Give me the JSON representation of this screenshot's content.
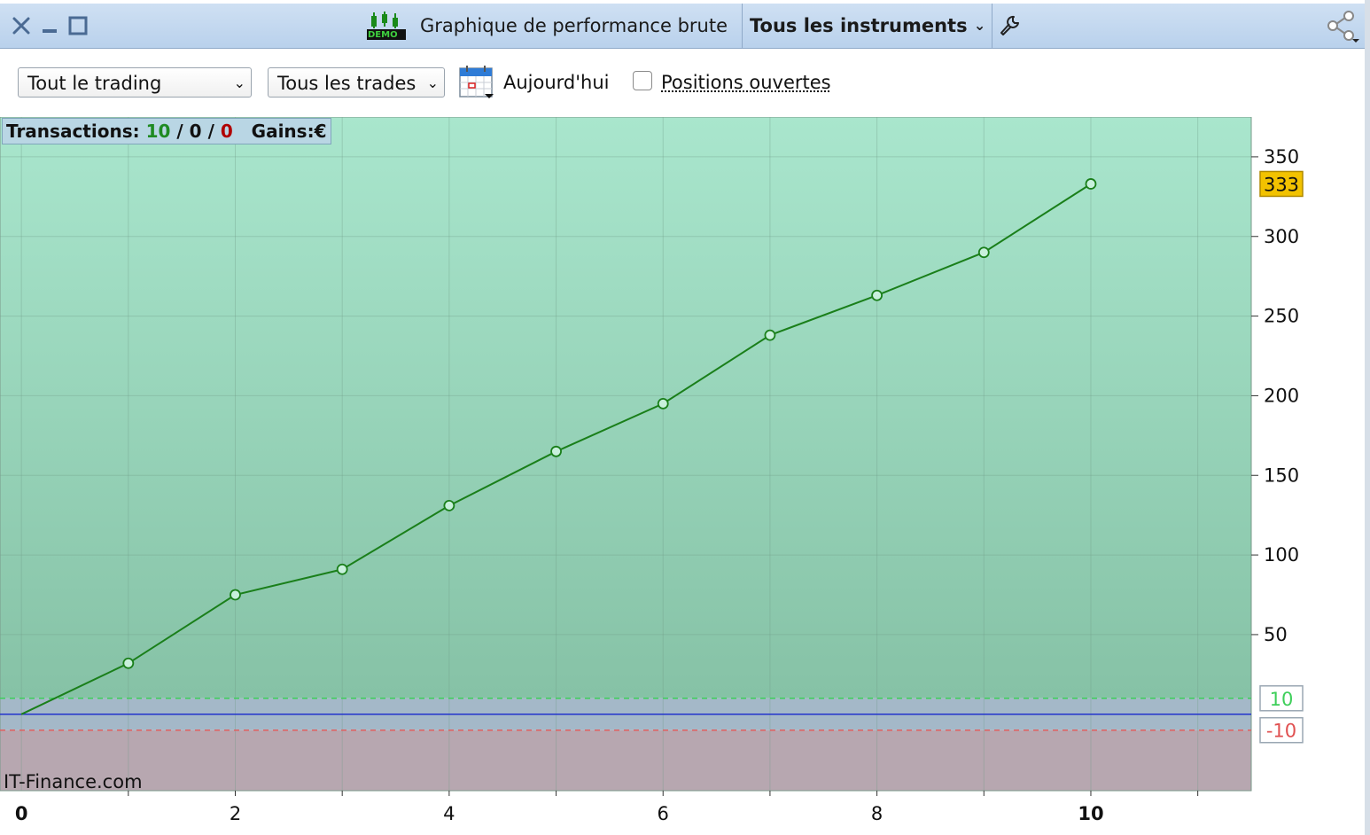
{
  "window": {
    "title": "Graphique de performance brute",
    "instrument_selector": "Tous les instruments",
    "badge": "DEMO"
  },
  "toolbar": {
    "period_select": "Tout le trading",
    "trades_select": "Tous les trades",
    "date_label": "Aujourd'hui",
    "open_positions_label": "Positions ouvertes",
    "open_positions_checked": false
  },
  "stats": {
    "transactions_label": "Transactions:",
    "wins": "10",
    "sep1": "/",
    "neutral": "0",
    "sep2": "/",
    "losses": "0",
    "gains_label": "Gains:",
    "currency": "€"
  },
  "watermark": "IT-Finance.com",
  "colors": {
    "line": "#1a7f1a",
    "profit_zone": "#8fcfb0",
    "loss_zone": "#b7a7b0",
    "zero_line": "#2233cc",
    "last_value_badge": "#f2c200"
  },
  "chart_data": {
    "type": "line",
    "x": [
      0,
      1,
      2,
      3,
      4,
      5,
      6,
      7,
      8,
      9,
      10
    ],
    "values": [
      0,
      32,
      75,
      91,
      131,
      165,
      195,
      238,
      263,
      290,
      333
    ],
    "xlim": [
      -0.2,
      11.5
    ],
    "ylim": [
      -48,
      375
    ],
    "x_ticks": [
      0,
      2,
      4,
      6,
      8,
      10
    ],
    "y_ticks": [
      50,
      100,
      150,
      200,
      250,
      300,
      350
    ],
    "last_value_label": "333",
    "upper_threshold": 10,
    "upper_threshold_label": "10",
    "lower_threshold": -10,
    "lower_threshold_label": "-10",
    "grid": true
  }
}
